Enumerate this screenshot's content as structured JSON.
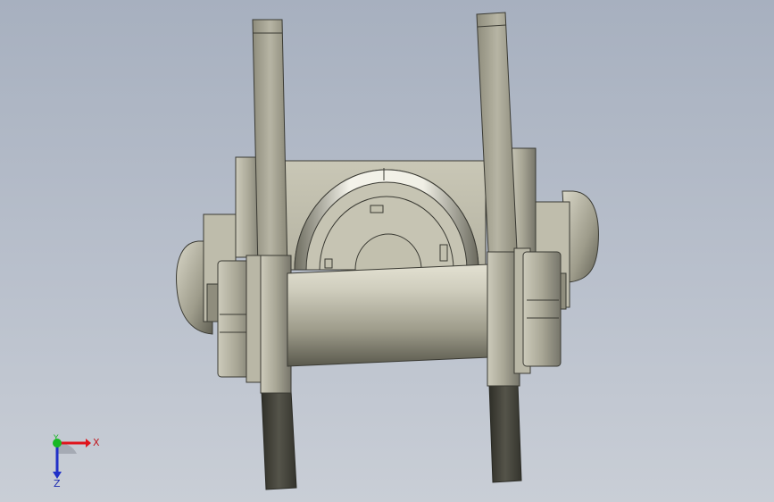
{
  "viewport": {
    "background_top": "#a7b0bf",
    "background_bottom": "#c9ced6",
    "part_color": "#b3b19f",
    "part_shadow": "#4b4b40",
    "part_highlight": "#e4e2d3"
  },
  "triad": {
    "x_label": "X",
    "y_label": "Y",
    "z_label": "Z",
    "x_color": "#e0141c",
    "y_color": "#18b823",
    "z_color": "#2030c8"
  }
}
